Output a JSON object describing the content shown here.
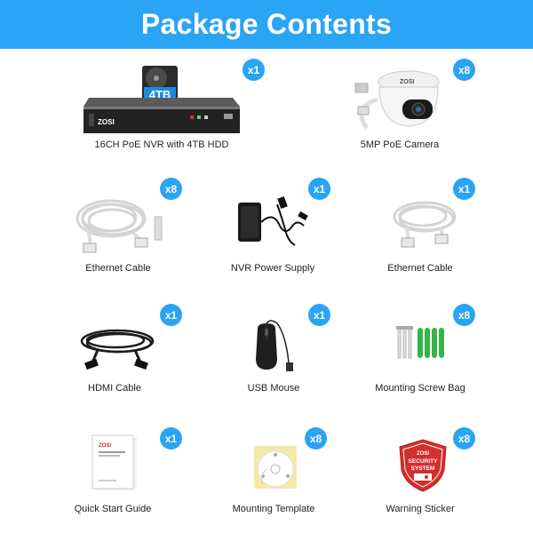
{
  "title": "Package Contents",
  "brand_color": "#2aa4f4",
  "items": [
    {
      "label": "16CH PoE NVR with 4TB HDD",
      "qty": "x1",
      "icon": "nvr-recorder-icon",
      "hdd_label": "4TB",
      "brand": "ZOSI"
    },
    {
      "label": "5MP PoE Camera",
      "qty": "x8",
      "icon": "dome-camera-icon",
      "brand": "ZOSI"
    },
    {
      "label": "Ethernet Cable",
      "qty": "x8",
      "icon": "ethernet-cable-icon"
    },
    {
      "label": "NVR Power Supply",
      "qty": "x1",
      "icon": "power-adapter-icon"
    },
    {
      "label": "Ethernet Cable",
      "qty": "x1",
      "icon": "ethernet-cable-icon"
    },
    {
      "label": "HDMI Cable",
      "qty": "x1",
      "icon": "hdmi-cable-icon"
    },
    {
      "label": "USB Mouse",
      "qty": "x1",
      "icon": "usb-mouse-icon"
    },
    {
      "label": "Mounting Screw Bag",
      "qty": "x8",
      "icon": "screw-bag-icon"
    },
    {
      "label": "Quick Start Guide",
      "qty": "x1",
      "icon": "quick-guide-icon",
      "brand": "ZOSI"
    },
    {
      "label": "Mounting Template",
      "qty": "x8",
      "icon": "mounting-template-icon"
    },
    {
      "label": "Warning Sticker",
      "qty": "x8",
      "icon": "warning-sticker-icon",
      "brand": "ZOSI",
      "sticker_text": [
        "SECURITY",
        "SYSTEM"
      ]
    }
  ]
}
